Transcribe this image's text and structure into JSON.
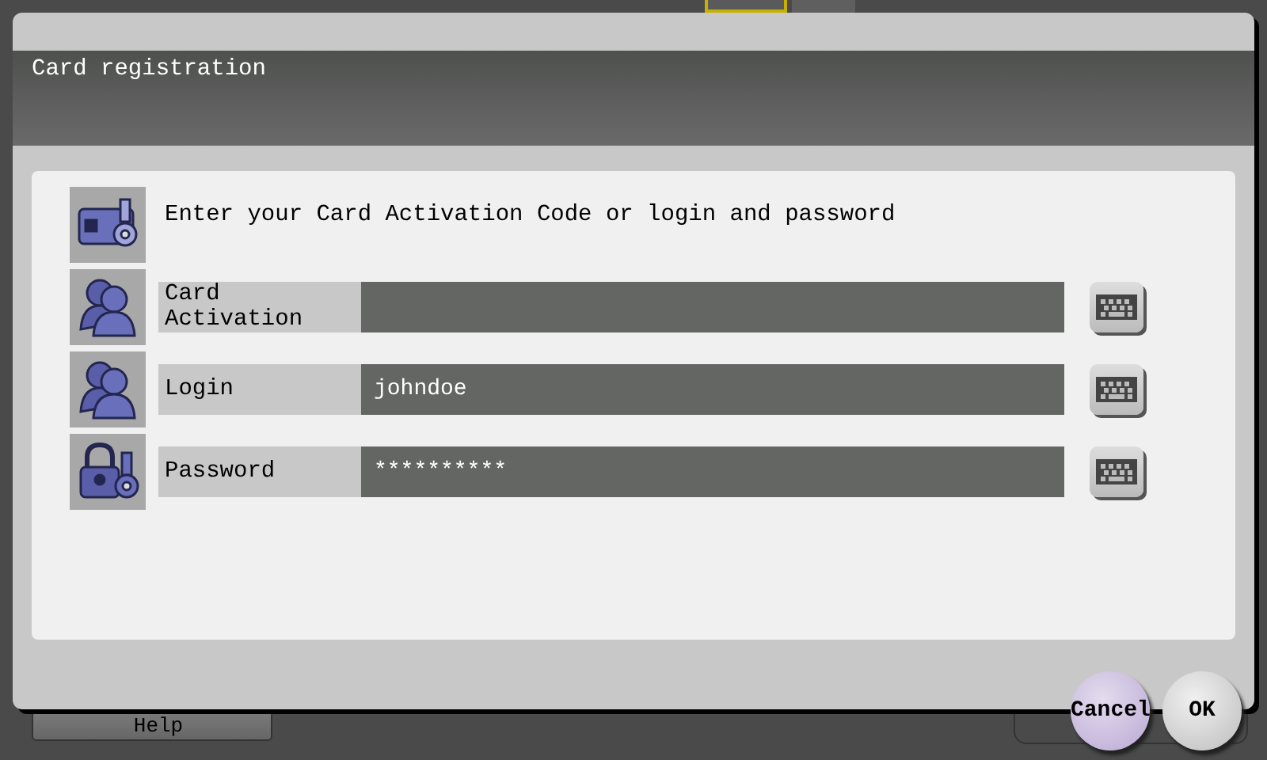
{
  "background": {
    "help_button": "Help"
  },
  "dialog": {
    "title": "Card registration",
    "instruction": "Enter your Card Activation Code or login and password",
    "fields": [
      {
        "kind": "person",
        "label": "Card Activation"
      },
      {
        "kind": "person",
        "label": "Login",
        "value": "johndoe"
      },
      {
        "kind": "lock",
        "label": "Password",
        "value": "**********"
      }
    ],
    "buttons": [
      {
        "kind": "cancel",
        "label": "Cancel"
      },
      {
        "kind": "ok",
        "label": "OK"
      }
    ]
  }
}
